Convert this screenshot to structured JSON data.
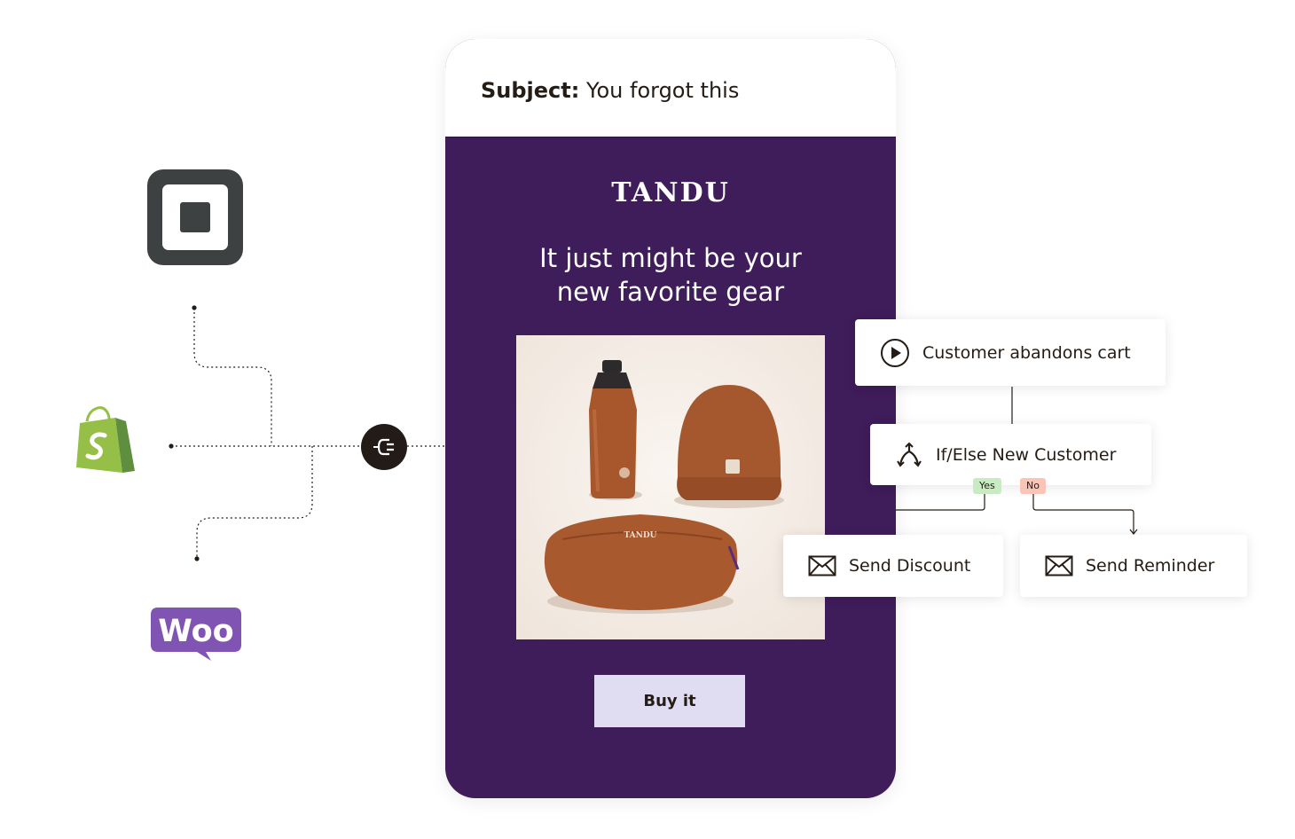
{
  "email": {
    "subject_label": "Subject:",
    "subject_text": "You forgot this",
    "brand": "TANDU",
    "headline_line1": "It just might be your",
    "headline_line2": "new favorite gear",
    "product_bag_brand": "TANDU",
    "cta_label": "Buy it",
    "colors": {
      "card_background": "#3f1c5a",
      "cta_background": "#e0dcf1"
    }
  },
  "integrations": [
    {
      "name": "Square",
      "icon": "square-logo-icon"
    },
    {
      "name": "Shopify",
      "icon": "shopify-bag-icon"
    },
    {
      "name": "WooCommerce",
      "icon": "woo-logo-icon",
      "wordmark": "Woo"
    }
  ],
  "workflow": {
    "trigger": {
      "label": "Customer abandons cart",
      "icon": "play-circle-icon"
    },
    "condition": {
      "label": "If/Else New Customer",
      "icon": "branch-split-icon"
    },
    "yes_label": "Yes",
    "no_label": "No",
    "actions": [
      {
        "label": "Send Discount",
        "icon": "envelope-icon"
      },
      {
        "label": "Send Reminder",
        "icon": "envelope-icon"
      }
    ],
    "colors": {
      "yes_tag": "#c9ebc4",
      "no_tag": "#f9c5b6"
    }
  }
}
